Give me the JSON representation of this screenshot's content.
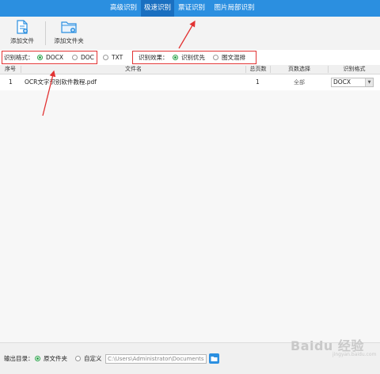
{
  "tabs": [
    "高级识别",
    "极速识别",
    "票证识别",
    "图片局部识别"
  ],
  "active_tab": 1,
  "toolbar": {
    "add_file": "添加文件",
    "add_folder": "添加文件夹"
  },
  "format": {
    "label": "识别格式：",
    "options": [
      "DOCX",
      "DOC",
      "TXT"
    ],
    "selected": "DOCX"
  },
  "effect": {
    "label": "识别效果：",
    "options": [
      "识别优先",
      "图文混排"
    ],
    "selected": "识别优先"
  },
  "table": {
    "headers": [
      "序号",
      "文件名",
      "总页数",
      "页数选择",
      "识别格式"
    ],
    "rows": [
      {
        "index": "1",
        "filename": "OCR文字识别软件教程.pdf",
        "pages": "1",
        "page_select": "全部",
        "format": "DOCX"
      }
    ]
  },
  "footer": {
    "label": "输出目录：",
    "opt_source": "原文件夹",
    "opt_custom": "自定义",
    "path": "C:\\Users\\Administrator\\Documents"
  },
  "watermark": {
    "main": "Baidu 经验",
    "sub": "jingyan.baidu.com"
  },
  "colors": {
    "tabbar": "#2b8fe0",
    "active_tab": "#1a6fc0",
    "highlight_box": "#e23232",
    "radio_on": "#2ca34b"
  }
}
